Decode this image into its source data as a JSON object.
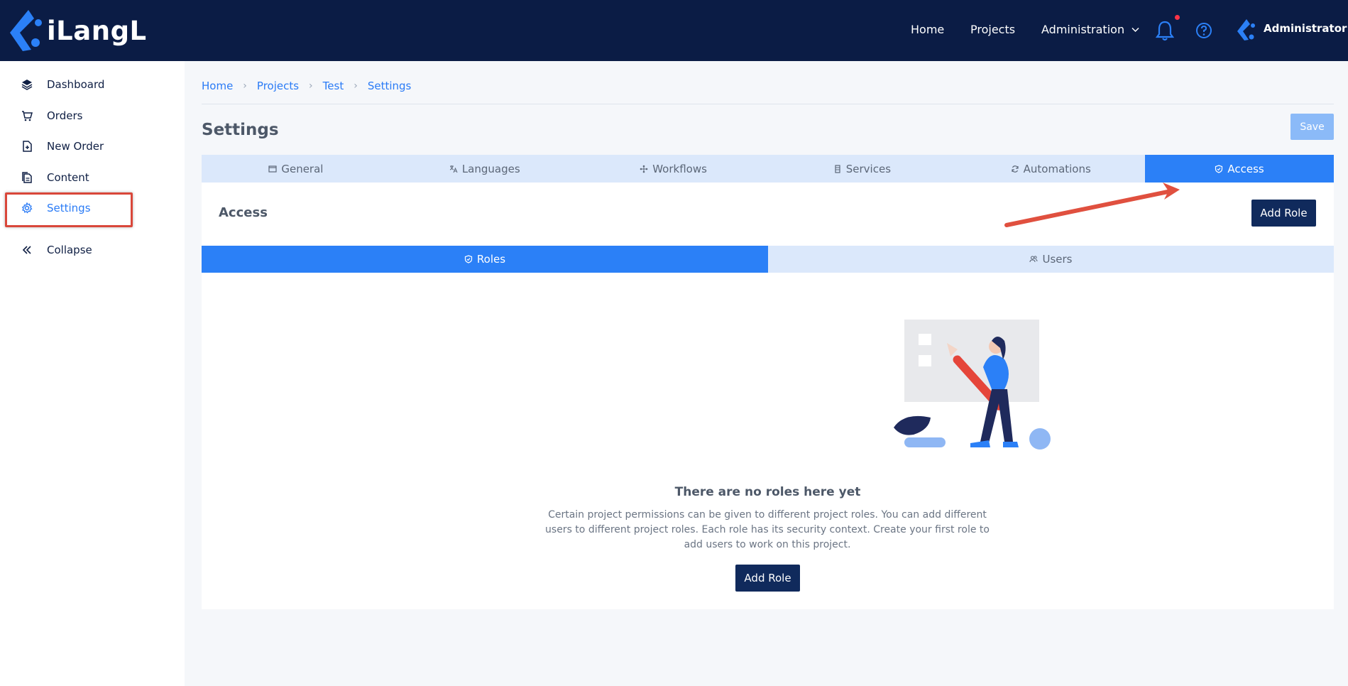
{
  "app": {
    "logo_text": "iLangL"
  },
  "topnav": {
    "home": "Home",
    "projects": "Projects",
    "administration": "Administration",
    "user": "Administrator"
  },
  "sidebar": {
    "items": [
      {
        "label": "Dashboard",
        "icon": "layers-icon"
      },
      {
        "label": "Orders",
        "icon": "cart-icon"
      },
      {
        "label": "New Order",
        "icon": "file-plus-icon"
      },
      {
        "label": "Content",
        "icon": "documents-icon"
      },
      {
        "label": "Settings",
        "icon": "gear-icon",
        "active": true
      },
      {
        "label": "Collapse",
        "icon": "double-chevron-left-icon"
      }
    ]
  },
  "breadcrumb": [
    "Home",
    "Projects",
    "Test",
    "Settings"
  ],
  "page": {
    "title": "Settings",
    "save_label": "Save"
  },
  "tabs": [
    {
      "label": "General",
      "icon": "window-icon"
    },
    {
      "label": "Languages",
      "icon": "translate-icon"
    },
    {
      "label": "Workflows",
      "icon": "workflow-icon"
    },
    {
      "label": "Services",
      "icon": "server-icon"
    },
    {
      "label": "Automations",
      "icon": "refresh-icon"
    },
    {
      "label": "Access",
      "icon": "shield-check-icon",
      "active": true
    }
  ],
  "access": {
    "title": "Access",
    "add_role_label": "Add Role",
    "subtabs": [
      {
        "label": "Roles",
        "icon": "shield-check-icon",
        "active": true
      },
      {
        "label": "Users",
        "icon": "users-icon"
      }
    ],
    "empty_title": "There are no roles here yet",
    "empty_description": "Certain project permissions can be given to different project roles. You can add different users to different project roles. Each role has its security context. Create your first role to add users to work on this project.",
    "empty_button_label": "Add Role"
  },
  "colors": {
    "topbar": "#0b1c45",
    "accent": "#2b80f7",
    "tab_bg": "#dbe8fb",
    "primary_button": "#102a5c",
    "annotation": "#e0503f"
  }
}
